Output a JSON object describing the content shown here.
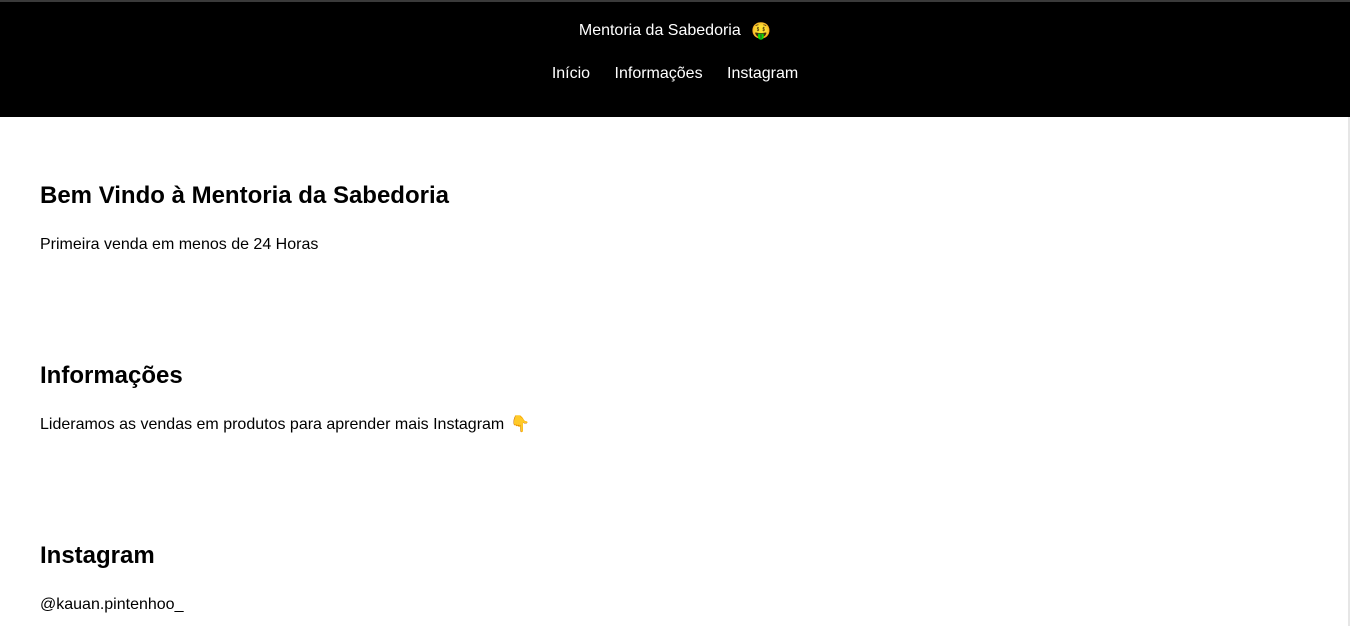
{
  "header": {
    "title": "Mentoria da Sabedoria",
    "title_emoji": "🤑",
    "nav": [
      {
        "label": "Início"
      },
      {
        "label": "Informações"
      },
      {
        "label": "Instagram"
      }
    ]
  },
  "sections": [
    {
      "heading": "Bem Vindo à Mentoria da Sabedoria",
      "text": "Primeira venda em menos de 24 Horas"
    },
    {
      "heading": "Informações",
      "text": "Lideramos as vendas em produtos para aprender mais Instagram",
      "emoji": "👇"
    },
    {
      "heading": "Instagram",
      "text": "@kauan.pintenhoo_"
    }
  ],
  "colors": {
    "header_bg": "#000000",
    "header_text": "#ffffff",
    "body_bg": "#ffffff",
    "body_text": "#000000"
  }
}
